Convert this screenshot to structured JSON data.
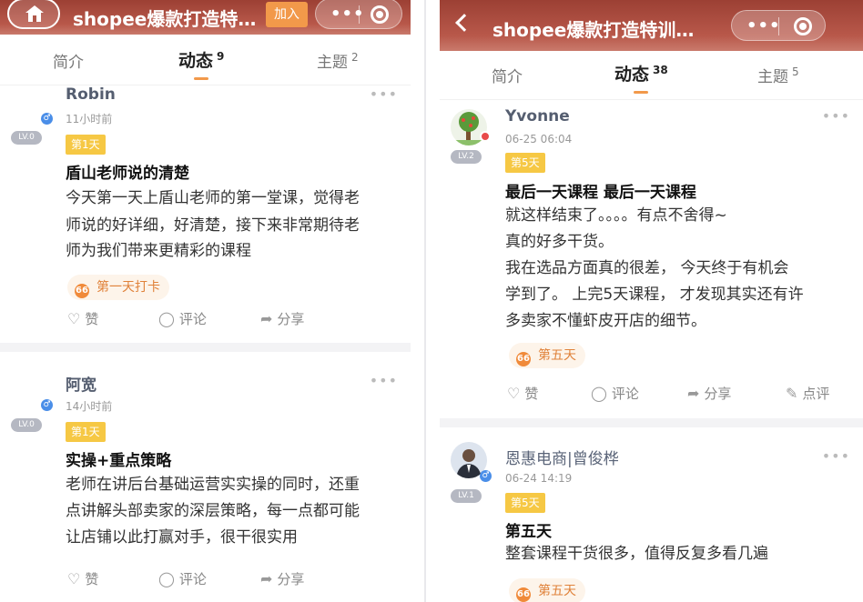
{
  "left": {
    "header": {
      "title": "shopee爆款打造特…",
      "join_label": "加入",
      "dots": "•••"
    },
    "tabs": [
      {
        "label": "简介",
        "count": ""
      },
      {
        "label": "动态",
        "count": "9"
      },
      {
        "label": "主题",
        "count": "2"
      }
    ],
    "posts": [
      {
        "name": "Robin",
        "time": "11小时前",
        "gender": "♂",
        "level": "LV.0",
        "day": "第1天",
        "title": "盾山老师说的清楚",
        "body": [
          "今天第一天上盾山老师的第一堂课，觉得老",
          "师说的好详细，好清楚，接下来非常期待老",
          "师为我们带来更精彩的课程"
        ],
        "tag": "第一天打卡",
        "actions": {
          "like": "赞",
          "comment": "评论",
          "share": "分享"
        }
      },
      {
        "name": "阿宽",
        "time": "14小时前",
        "gender": "♂",
        "level": "LV.0",
        "day": "第1天",
        "title": "实操+重点策略",
        "body": [
          "老师在讲后台基础运营实实操的同时，还重",
          "点讲解头部卖家的深层策略，每一点都可能",
          "让店铺以此打赢对手，很干很实用"
        ],
        "actions": {
          "like": "赞",
          "comment": "评论",
          "share": "分享"
        }
      }
    ]
  },
  "right": {
    "header": {
      "title": "shopee爆款打造特训…",
      "dots": "•••"
    },
    "tabs": [
      {
        "label": "简介",
        "count": ""
      },
      {
        "label": "动态",
        "count": "38"
      },
      {
        "label": "主题",
        "count": "5"
      }
    ],
    "posts": [
      {
        "name": "Yvonne",
        "time": "06-25 06:04",
        "level": "LV.2",
        "day": "第5天",
        "title": "最后一天课程 最后一天课程",
        "body": [
          "就这样结束了。。。。有点不舍得~",
          "真的好多干货。",
          "我在选品方面真的很差， 今天终于有机会",
          "学到了。 上完5天课程， 才发现其实还有许",
          "多卖家不懂虾皮开店的细节。"
        ],
        "tag": "第五天",
        "actions": {
          "like": "赞",
          "comment": "评论",
          "share": "分享",
          "review": "点评"
        }
      },
      {
        "name": "恩惠电商|曾俊桦",
        "time": "06-24 14:19",
        "gender": "♂",
        "level": "LV.1",
        "day": "第5天",
        "title": "第五天",
        "body": [
          "整套课程干货很多，值得反复多看几遍"
        ],
        "tag": "第五天"
      }
    ]
  },
  "colors": {
    "header": "#a84a3c",
    "accent": "#f2994a",
    "day_badge": "#f6c844",
    "level_badge": "#b5b8c2",
    "gender": "#4a8ee8"
  }
}
